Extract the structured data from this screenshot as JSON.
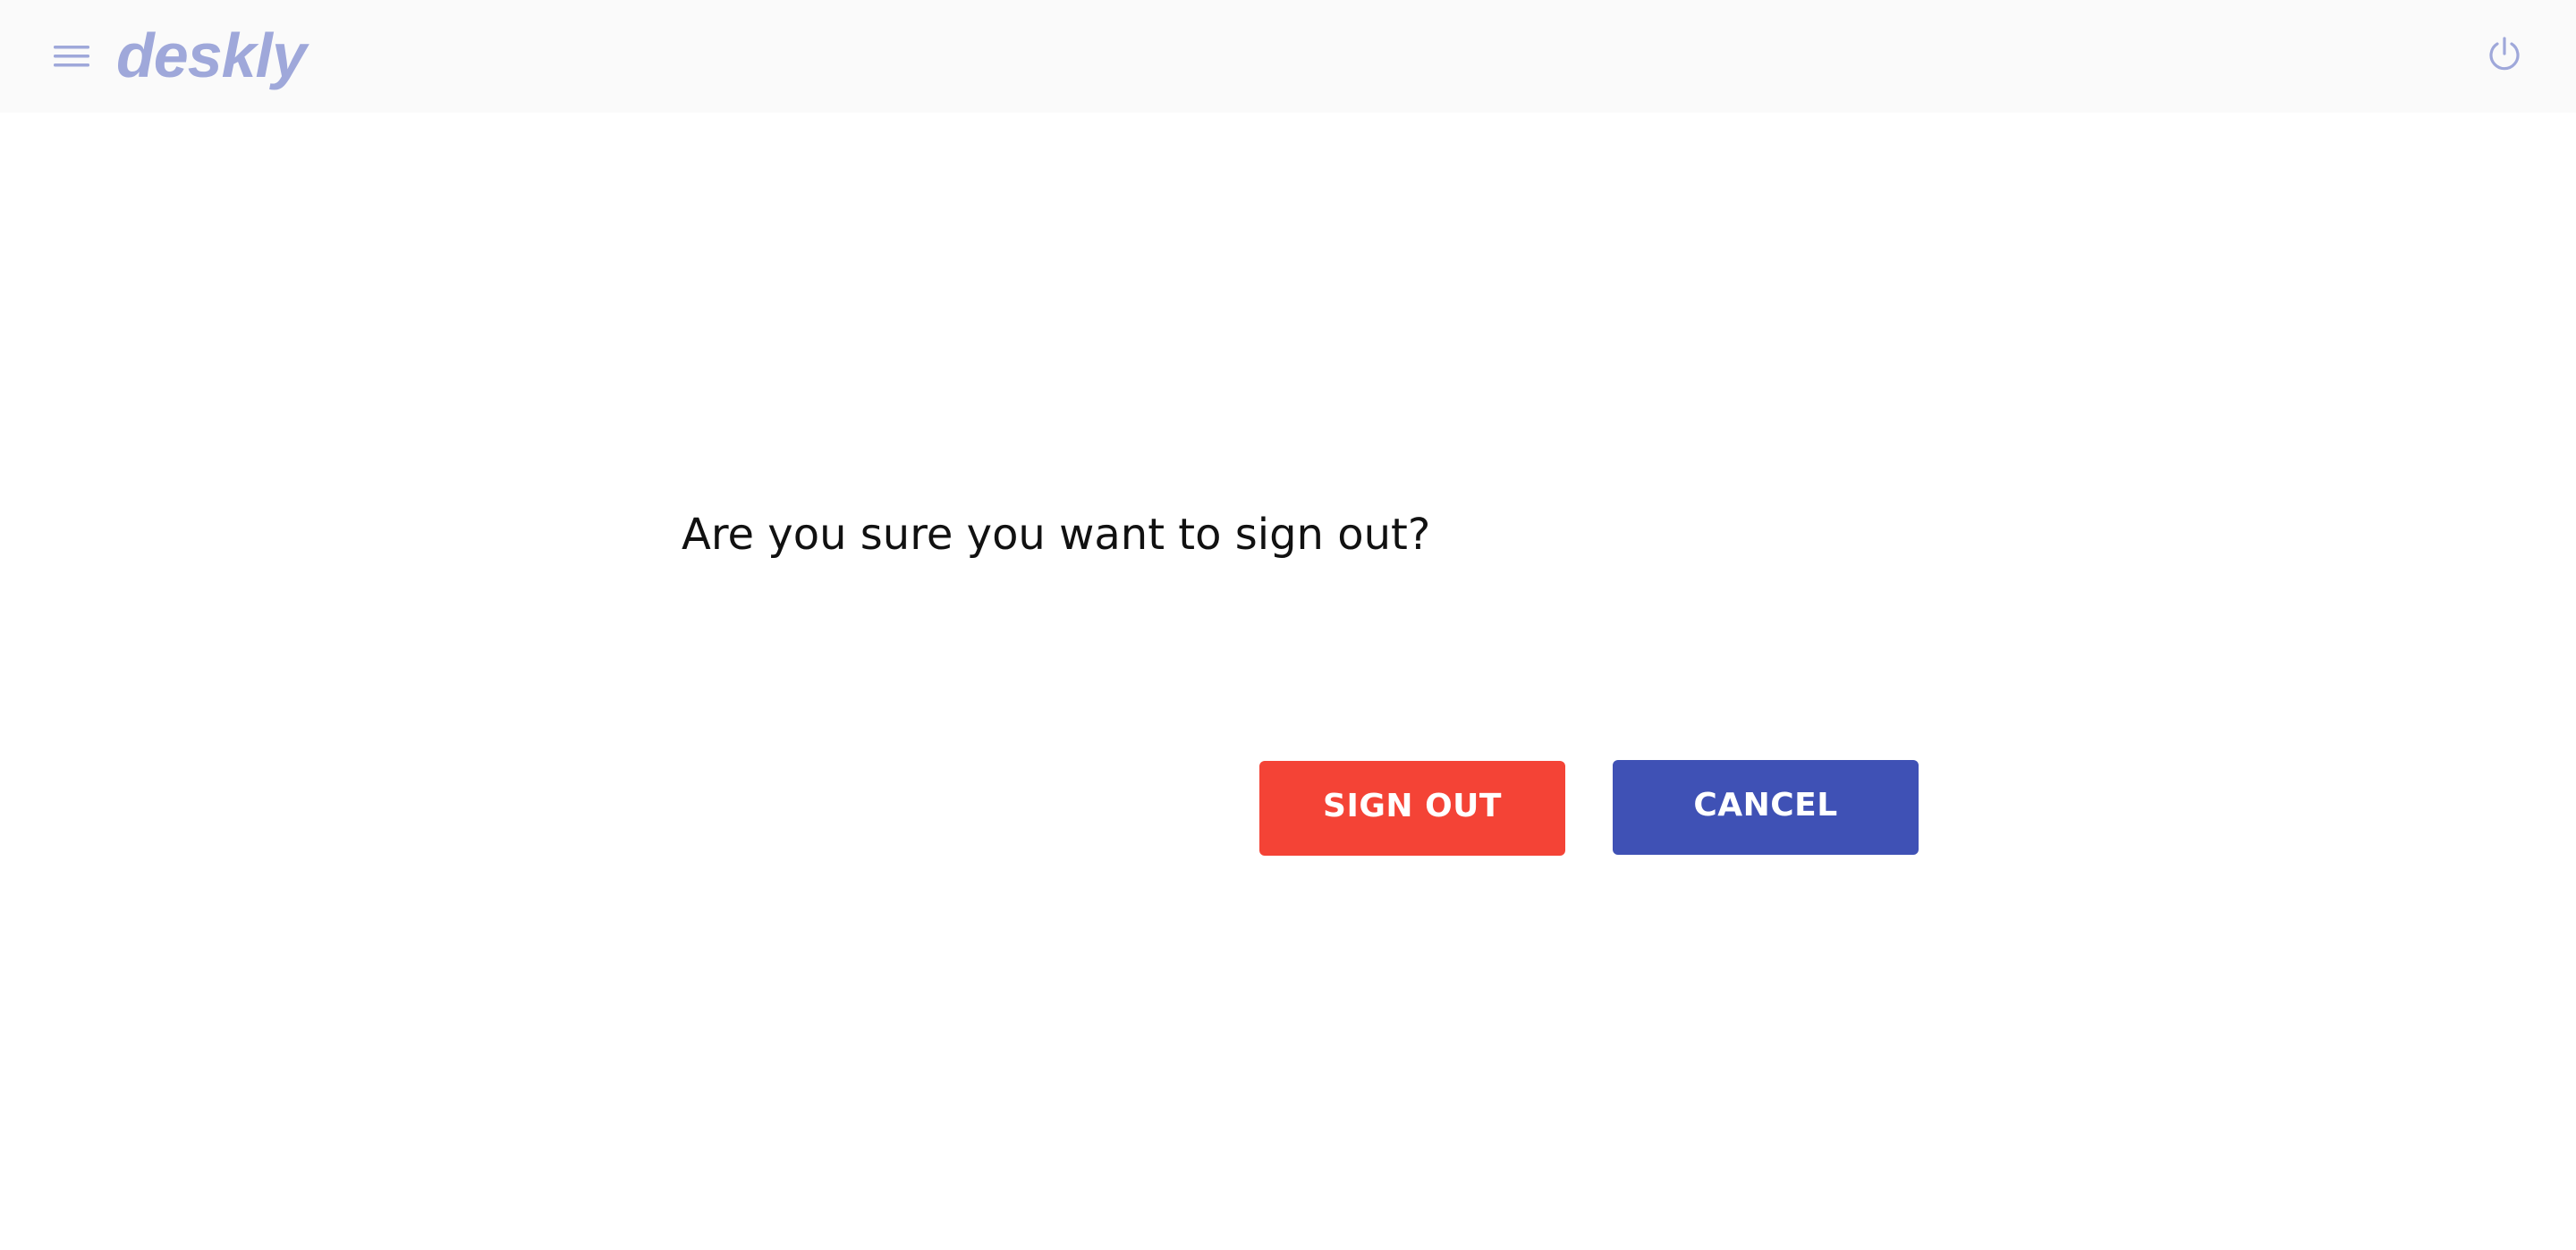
{
  "header": {
    "logo_text": "deskly",
    "menu_icon": "hamburger-menu-icon",
    "power_icon": "power-icon"
  },
  "dialog": {
    "message": "Are you sure you want to sign out?",
    "sign_out_label": "SIGN OUT",
    "cancel_label": "CANCEL"
  },
  "colors": {
    "header_background": "#fafafa",
    "logo_and_icons": "#9fa8da",
    "sign_out_button": "#f44336",
    "cancel_button": "#3f51b5",
    "button_text": "#ffffff",
    "message_text": "#111111"
  }
}
